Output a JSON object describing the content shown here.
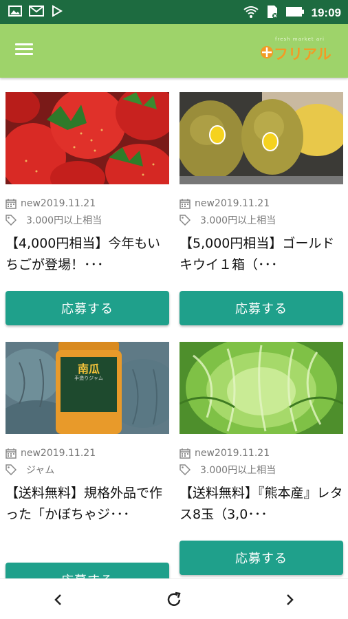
{
  "status_bar": {
    "time": "19:09",
    "icons": [
      "image-icon",
      "gmail-icon",
      "play-store-icon",
      "wifi-icon",
      "sim-icon",
      "battery-icon"
    ]
  },
  "app_bar": {
    "logo_tagline": "fresh market ari",
    "logo_name": "フリアル",
    "colors": {
      "bar": "#9ed36a",
      "logo": "#f29b25"
    }
  },
  "cards": [
    {
      "image": "strawberries",
      "date": "new2019.11.21",
      "tag": "3.000円以上相当",
      "title": "【4,000円相当】今年もいちごが登場！･･･",
      "button": "応募する"
    },
    {
      "image": "gold-kiwi",
      "date": "new2019.11.21",
      "tag": "3.000円以上相当",
      "title": "【5,000円相当】ゴールドキウイ１箱（･･･",
      "button": "応募する"
    },
    {
      "image": "pumpkin-jam",
      "date": "new2019.11.21",
      "tag": "ジャム",
      "title": "【送料無料】規格外品で作った「かぼちゃジ･･･",
      "button": "応募する"
    },
    {
      "image": "lettuce",
      "date": "new2019.11.21",
      "tag": "3.000円以上相当",
      "title": "【送料無料】『熊本産』レタス8玉（3,0･･･",
      "button": "応募する"
    }
  ],
  "jam_label": {
    "line1": "南瓜",
    "line2": "手造りジャム"
  },
  "nav": {
    "back": "back-icon",
    "reload": "reload-icon",
    "forward": "forward-icon"
  },
  "colors": {
    "status": "#1d6b40",
    "button": "#1fa08b"
  }
}
